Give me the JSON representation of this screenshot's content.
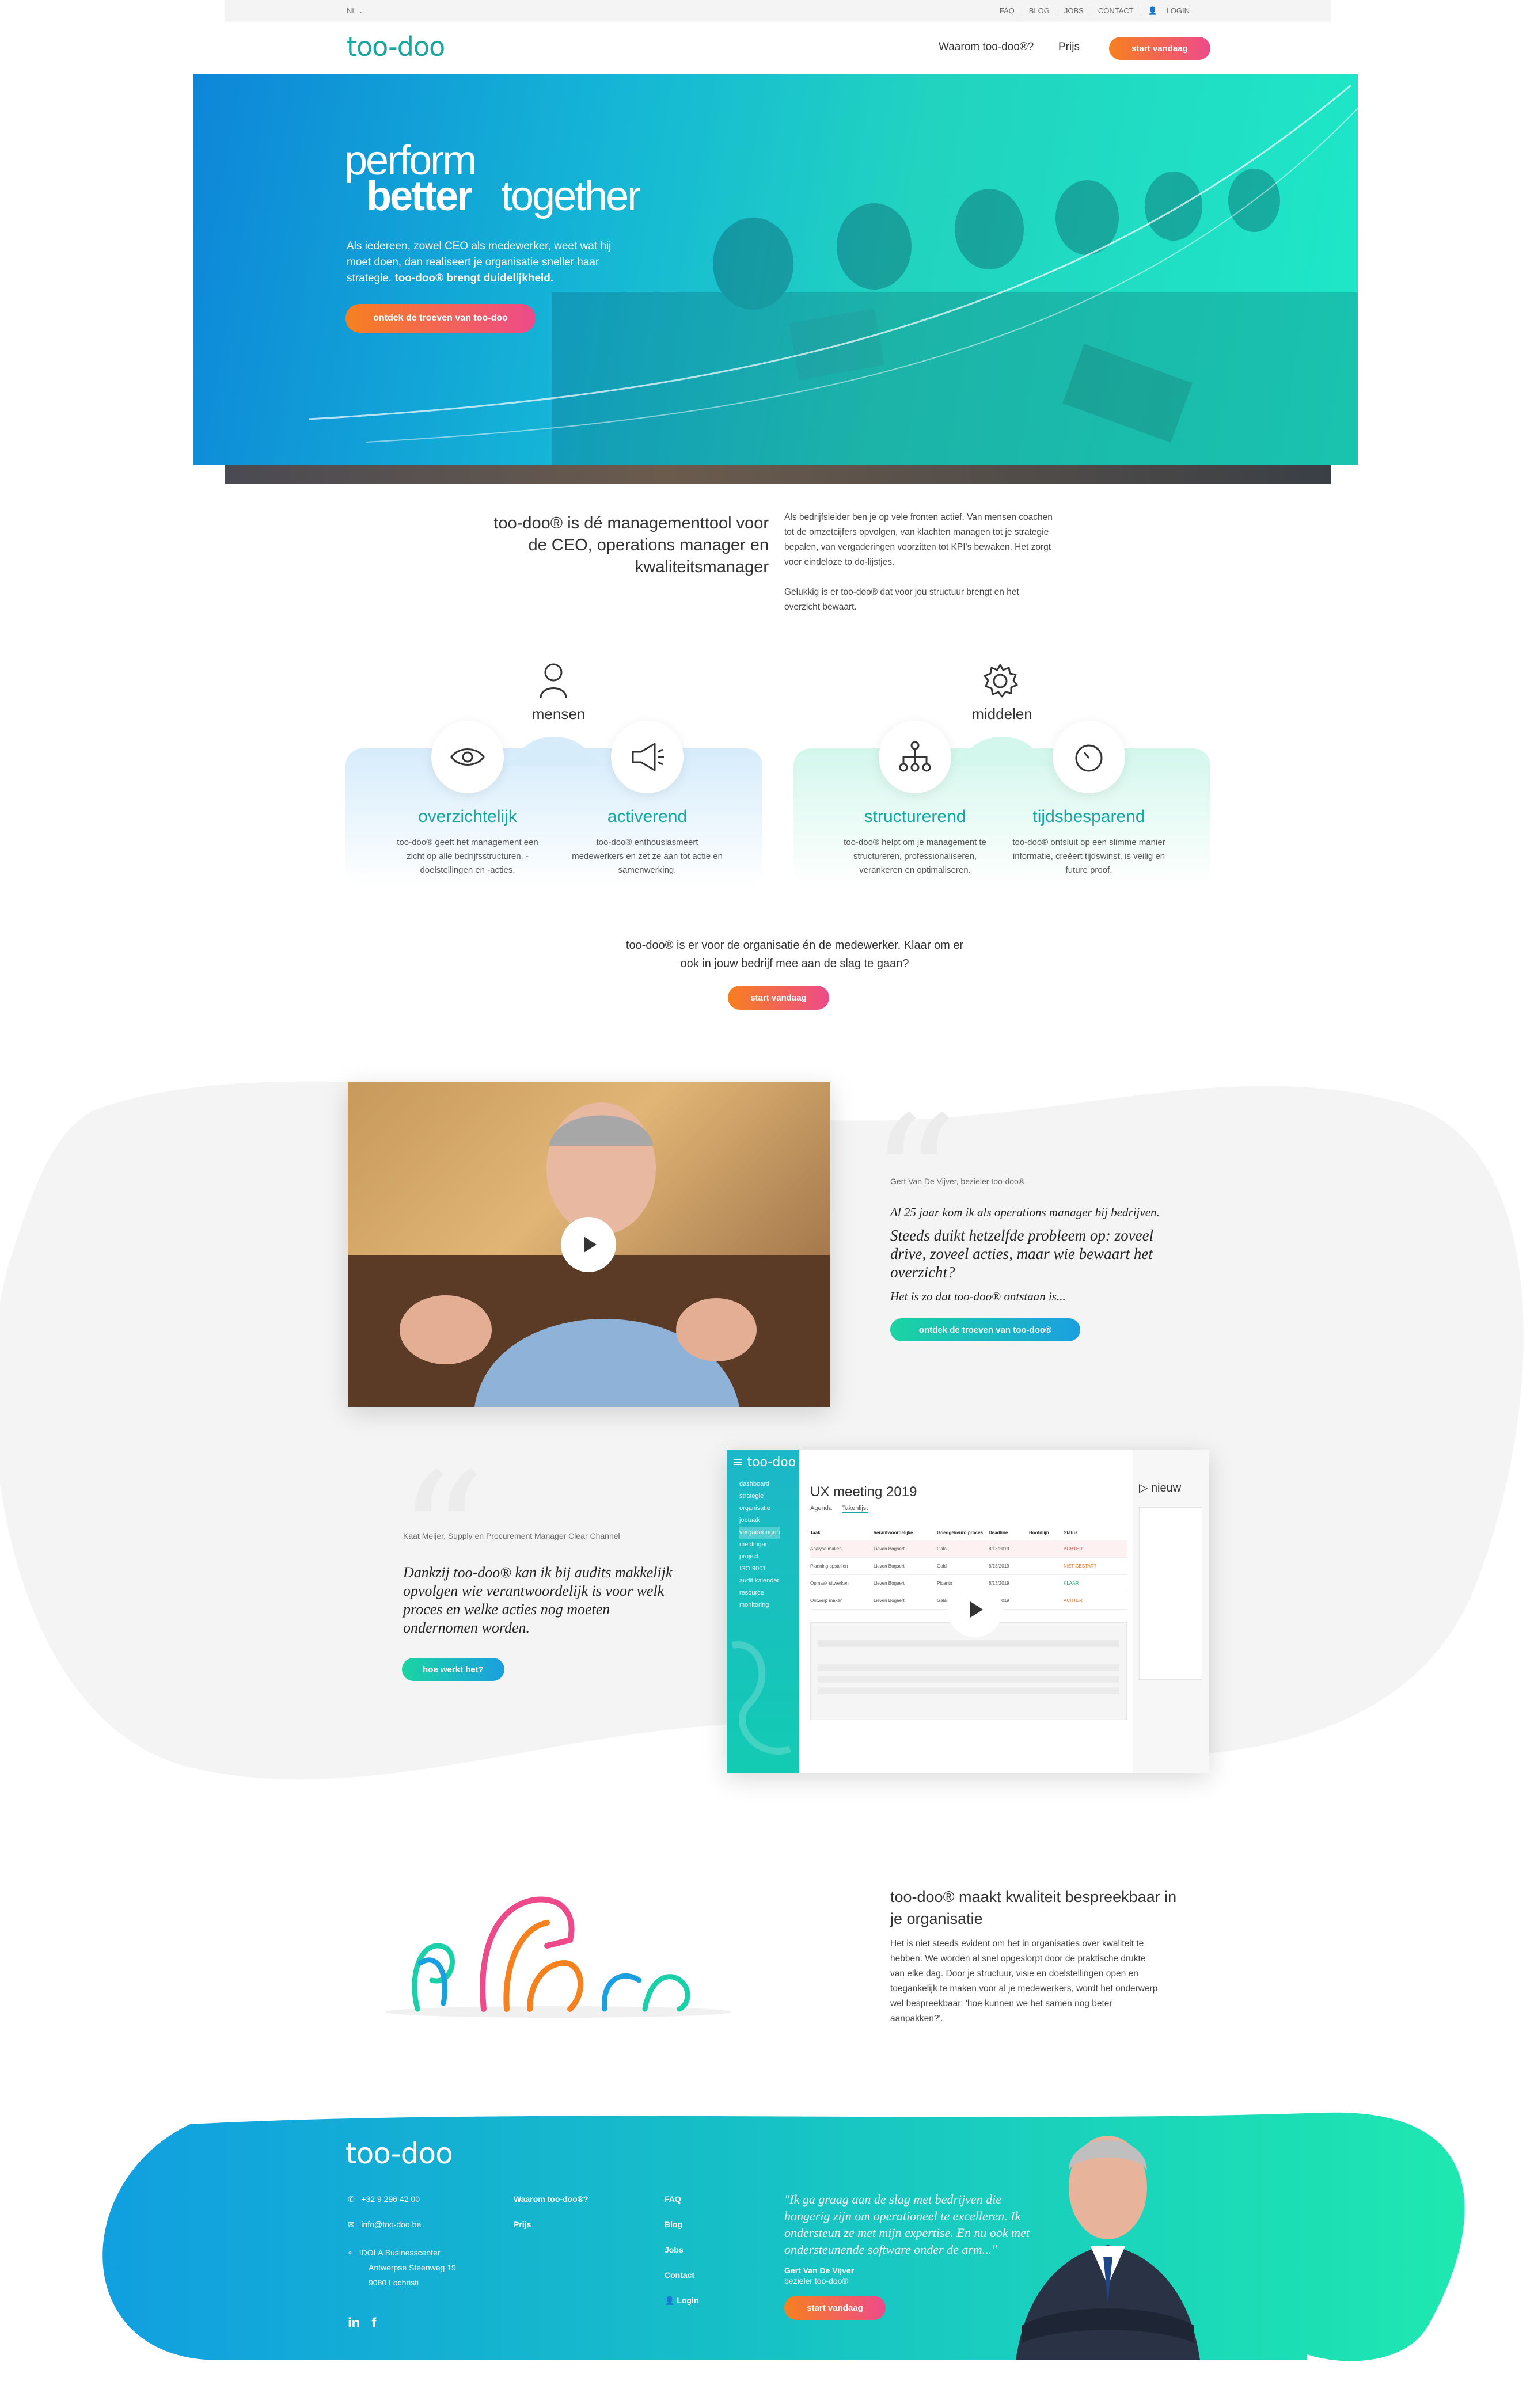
{
  "topbar": {
    "lang": "NL",
    "links": [
      "FAQ",
      "BLOG",
      "JOBS",
      "CONTACT",
      "LOGIN"
    ]
  },
  "nav": {
    "logo": "too-doo",
    "items": [
      "Waarom too-doo®?",
      "Prijs"
    ],
    "cta": "start vandaag"
  },
  "hero": {
    "line1": "perform",
    "line2": "better",
    "line3": "together",
    "text": "Als iedereen, zowel CEO als medewerker, weet wat hij moet doen, dan realiseert je organisatie sneller haar strategie.",
    "text_bold": "too-doo® brengt duidelijkheid.",
    "cta": "ontdek de troeven van too-doo"
  },
  "intro": {
    "title": "too-doo® is dé managementtool voor de CEO, operations manager en kwaliteitsmanager",
    "p1": "Als bedrijfsleider ben je op vele fronten actief. Van mensen coachen tot de omzetcijfers opvolgen, van klachten managen tot je strategie bepalen, van vergaderingen voorzitten tot KPI's bewaken. Het zorgt voor eindeloze to do-lijstjes.",
    "p2": "Gelukkig is er too-doo® dat voor jou structuur brengt en het overzicht bewaart."
  },
  "features": {
    "group1": "mensen",
    "group2": "middelen",
    "items": [
      {
        "title": "overzichtelijk",
        "text": "too-doo® geeft het management een zicht op alle bedrijfsstructuren, -doelstellingen en -acties."
      },
      {
        "title": "activerend",
        "text": "too-doo® enthousiasmeert medewerkers en zet ze aan tot actie en samenwerking."
      },
      {
        "title": "structurerend",
        "text": "too-doo® helpt om je management te structureren, professionaliseren, verankeren en optimaliseren."
      },
      {
        "title": "tijdsbesparend",
        "text": "too-doo® ontsluit op een slimme manier informatie, creëert tijdswinst, is veilig en future proof."
      }
    ]
  },
  "cta_section": {
    "text": "too-doo® is er voor de organisatie én de medewerker. Klaar om er ook in jouw bedrijf mee aan de slag te gaan?",
    "button": "start vandaag"
  },
  "testimonial1": {
    "name": "Gert Van De Vijver, bezieler too-doo®",
    "line1": "Al 25 jaar kom ik als operations manager bij bedrijven.",
    "line2": "Steeds duikt hetzelfde probleem op: zoveel drive, zoveel acties, maar wie bewaart het overzicht?",
    "line3": "Het is zo dat too-doo® ontstaan is...",
    "button": "ontdek de troeven van too-doo®"
  },
  "testimonial2": {
    "name": "Kaat Meijer, Supply en Procurement Manager Clear Channel",
    "quote": "Dankzij too-doo® kan ik bij audits makkelijk opvolgen wie verantwoordelijk is voor welk proces en welke acties nog moeten ondernomen worden.",
    "button": "hoe werkt het?"
  },
  "app": {
    "logo": "too-doo",
    "title": "UX meeting 2019",
    "side_items": [
      "dashboard",
      "strategie",
      "organisatie",
      "jobtaak",
      "vergaderingen",
      "meldingen",
      "project",
      "ISO 9001",
      "audit kalender",
      "resource",
      "monitoring"
    ],
    "tabs": [
      "Agenda",
      "Takenlijst"
    ],
    "columns": [
      "Taak",
      "Verantwoordelijke",
      "Goedgekeurd proces",
      "Deadline",
      "Hoofdlijn",
      "Status"
    ],
    "rows": [
      {
        "task": "Analyse maken",
        "owner": "Lieven Bogaert",
        "proc": "Gala",
        "deadline": "8/13/2019",
        "status": "ACHTER"
      },
      {
        "task": "Planning opstellen",
        "owner": "Lieven Bogaert",
        "proc": "Gold",
        "deadline": "8/13/2019",
        "status": "NIET GESTART"
      },
      {
        "task": "Opmaak uitwerken",
        "owner": "Lieven Bogaert",
        "proc": "Picanto",
        "deadline": "8/13/2019",
        "status": "KLAAR"
      },
      {
        "task": "Ontwerp maken",
        "owner": "Lieven Bogaert",
        "proc": "Gala",
        "deadline": "8/13/2019",
        "status": "ACHTER"
      }
    ],
    "right_title": "nieuw"
  },
  "quality": {
    "title": "too-doo® maakt kwaliteit bespreekbaar in je organisatie",
    "text": "Het is niet steeds evident om het in organisaties over kwaliteit te hebben. We worden al snel opgeslorpt door de praktische drukte van elke dag. Door je structuur, visie en doelstellingen open en toegankelijk te maken voor al je medewerkers, wordt het onderwerp wel bespreekbaar: 'hoe kunnen we het samen nog beter aanpakken?'."
  },
  "footer": {
    "logo": "too-doo",
    "phone": "+32 9 296 42 00",
    "email": "info@too-doo.be",
    "addr1": "IDOLA Businesscenter",
    "addr2": "Antwerpse Steenweg 19",
    "addr3": "9080 Lochristi",
    "col1": [
      "Waarom too-doo®?",
      "Prijs"
    ],
    "col2": [
      "FAQ",
      "Blog",
      "Jobs",
      "Contact",
      "Login"
    ],
    "quote": "\"Ik ga graag aan de slag met bedrijven die hongerig zijn om operationeel te excelleren. Ik ondersteun ze met mijn expertise. En nu ook met ondersteunende software onder de arm...\"",
    "name": "Gert Van De Vijver",
    "role": "bezieler too-doo®",
    "cta": "start vandaag"
  },
  "colors": {
    "teal": "#1aa6a0",
    "orange": "#f7801f",
    "pink": "#ee4a8a",
    "blue": "#0d86d8"
  }
}
